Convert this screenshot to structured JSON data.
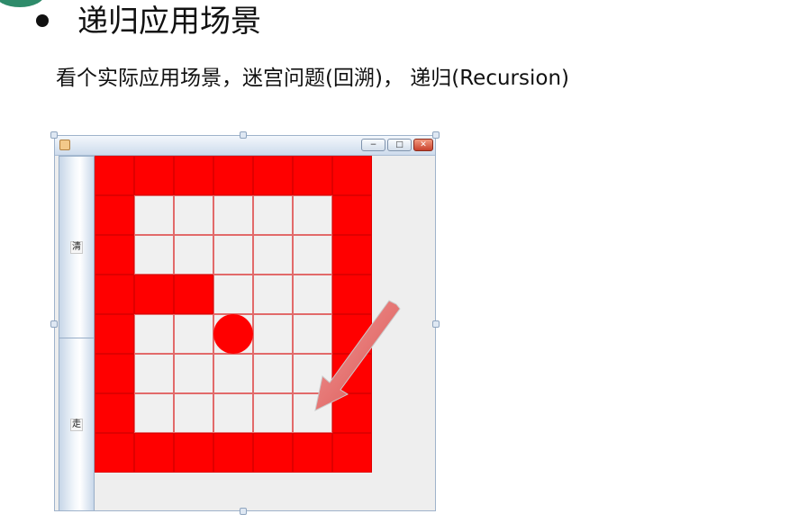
{
  "heading": "递归应用场景",
  "subtitle": "看个实际应用场景，迷宫问题(回溯)， 递归(Recursion)",
  "window": {
    "minimize_glyph": "−",
    "maximize_glyph": "□",
    "close_glyph": "✕",
    "side_buttons": [
      {
        "label": "清"
      },
      {
        "label": "走"
      }
    ]
  },
  "colors": {
    "wall": "#ff0000",
    "open": "#f0f0f0",
    "grid_line": "#e26a6a",
    "ball": "#ff0000",
    "arrow": "#e77b7b"
  },
  "maze": {
    "rows": 8,
    "cols": 7,
    "grid": [
      [
        1,
        1,
        1,
        1,
        1,
        1,
        1
      ],
      [
        1,
        0,
        0,
        0,
        0,
        0,
        1
      ],
      [
        1,
        0,
        0,
        0,
        0,
        0,
        1
      ],
      [
        1,
        1,
        1,
        0,
        0,
        0,
        1
      ],
      [
        1,
        0,
        0,
        0,
        0,
        0,
        1
      ],
      [
        1,
        0,
        0,
        0,
        0,
        0,
        1
      ],
      [
        1,
        0,
        0,
        0,
        0,
        0,
        1
      ],
      [
        1,
        1,
        1,
        1,
        1,
        1,
        1
      ]
    ],
    "ball": {
      "row": 4,
      "col": 3
    }
  }
}
